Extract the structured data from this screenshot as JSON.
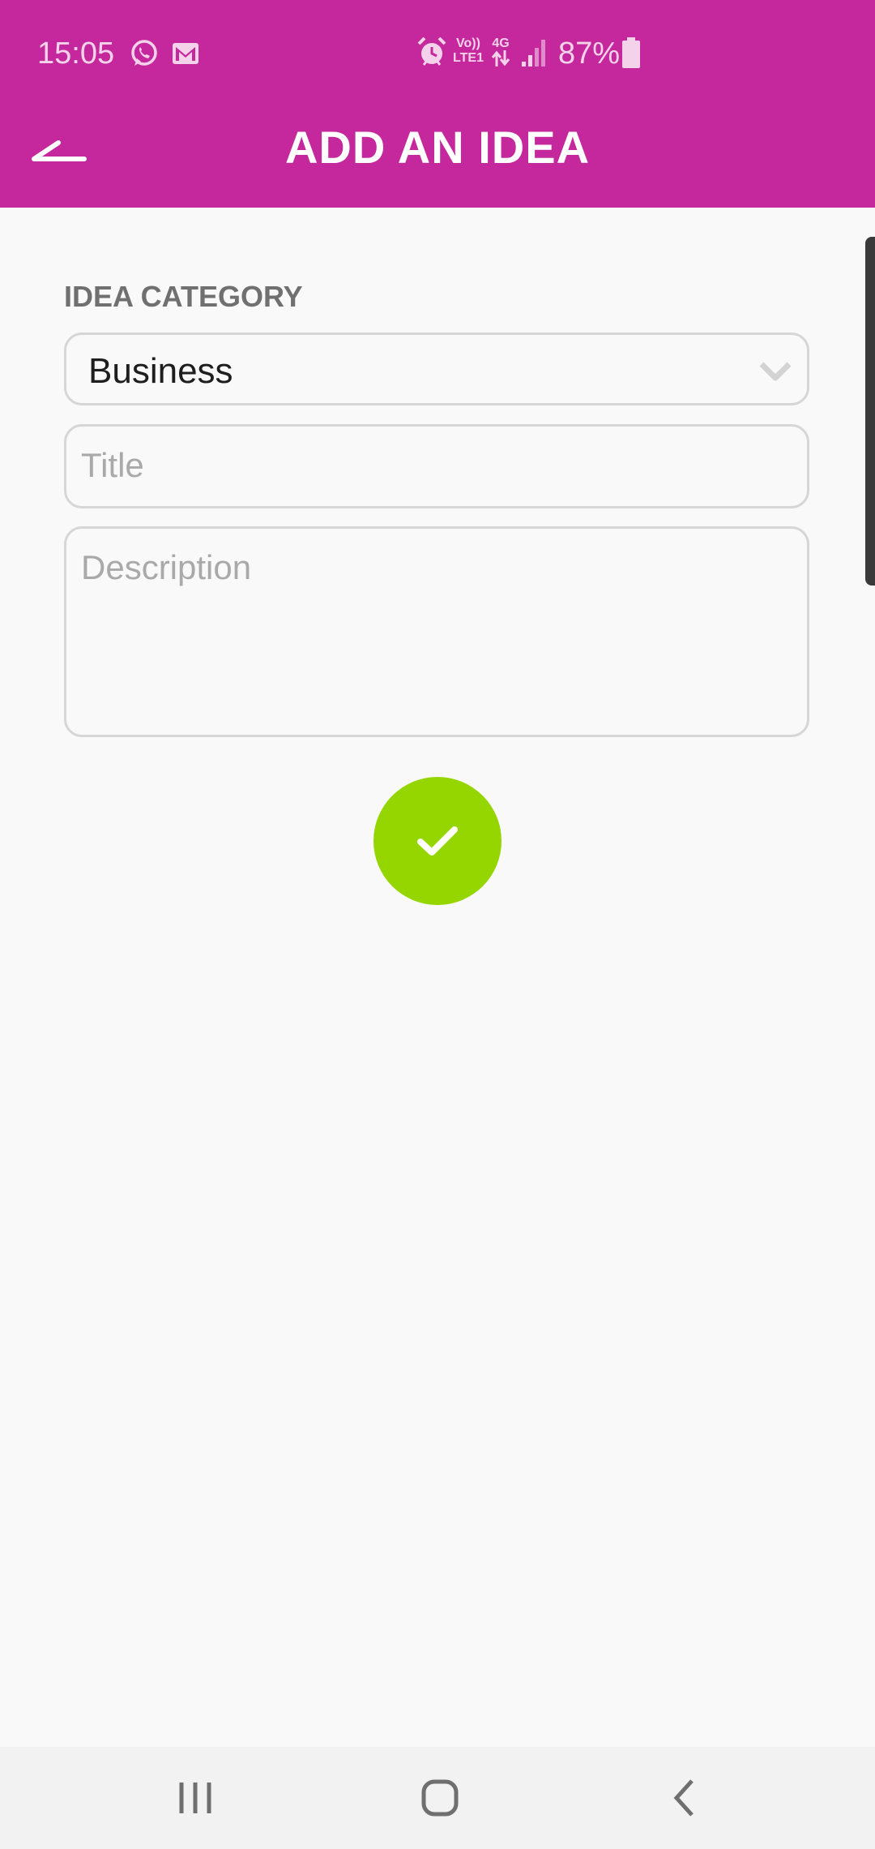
{
  "status_bar": {
    "time": "15:05",
    "volte": "Vo))",
    "lte": "LTE1",
    "network": "4G",
    "battery_percent": "87%",
    "icons": [
      "whatsapp-icon",
      "gmail-icon",
      "alarm-icon",
      "data-arrows-icon",
      "signal-icon",
      "battery-icon"
    ]
  },
  "app_bar": {
    "title": "ADD AN IDEA",
    "back_icon": "back-arrow-icon"
  },
  "form": {
    "category_label": "IDEA CATEGORY",
    "category_selected": "Business",
    "title_placeholder": "Title",
    "description_placeholder": "Description",
    "submit_icon": "check-icon"
  },
  "navigation_bar": {
    "icons": [
      "recent-apps-icon",
      "home-icon",
      "back-icon"
    ]
  },
  "colors": {
    "app_bar": "#c5279c",
    "submit": "#96d600",
    "background": "#f9f9f9"
  }
}
